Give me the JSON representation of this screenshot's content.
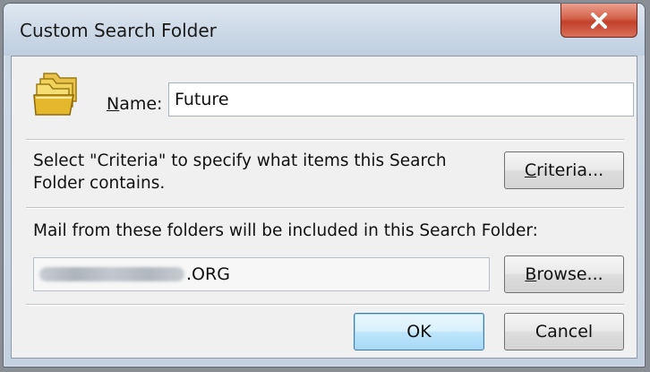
{
  "window": {
    "title": "Custom Search Folder",
    "close_glyph": "x"
  },
  "name": {
    "label_underlined": "N",
    "label_rest": "ame:",
    "value": "Future"
  },
  "criteria": {
    "description": "Select \"Criteria\" to specify what items this Search Folder contains.",
    "button_underlined": "C",
    "button_rest": "riteria..."
  },
  "folders": {
    "description": "Mail from these folders will be included in this Search Folder:",
    "visible_value": ".ORG",
    "browse_underlined": "B",
    "browse_rest": "rowse..."
  },
  "buttons": {
    "ok": "OK",
    "cancel": "Cancel"
  },
  "icons": {
    "folder": "search-folder-icon",
    "close": "close-icon"
  },
  "colors": {
    "close_button": "#c2402a",
    "default_button_border": "#3c7fb1"
  }
}
